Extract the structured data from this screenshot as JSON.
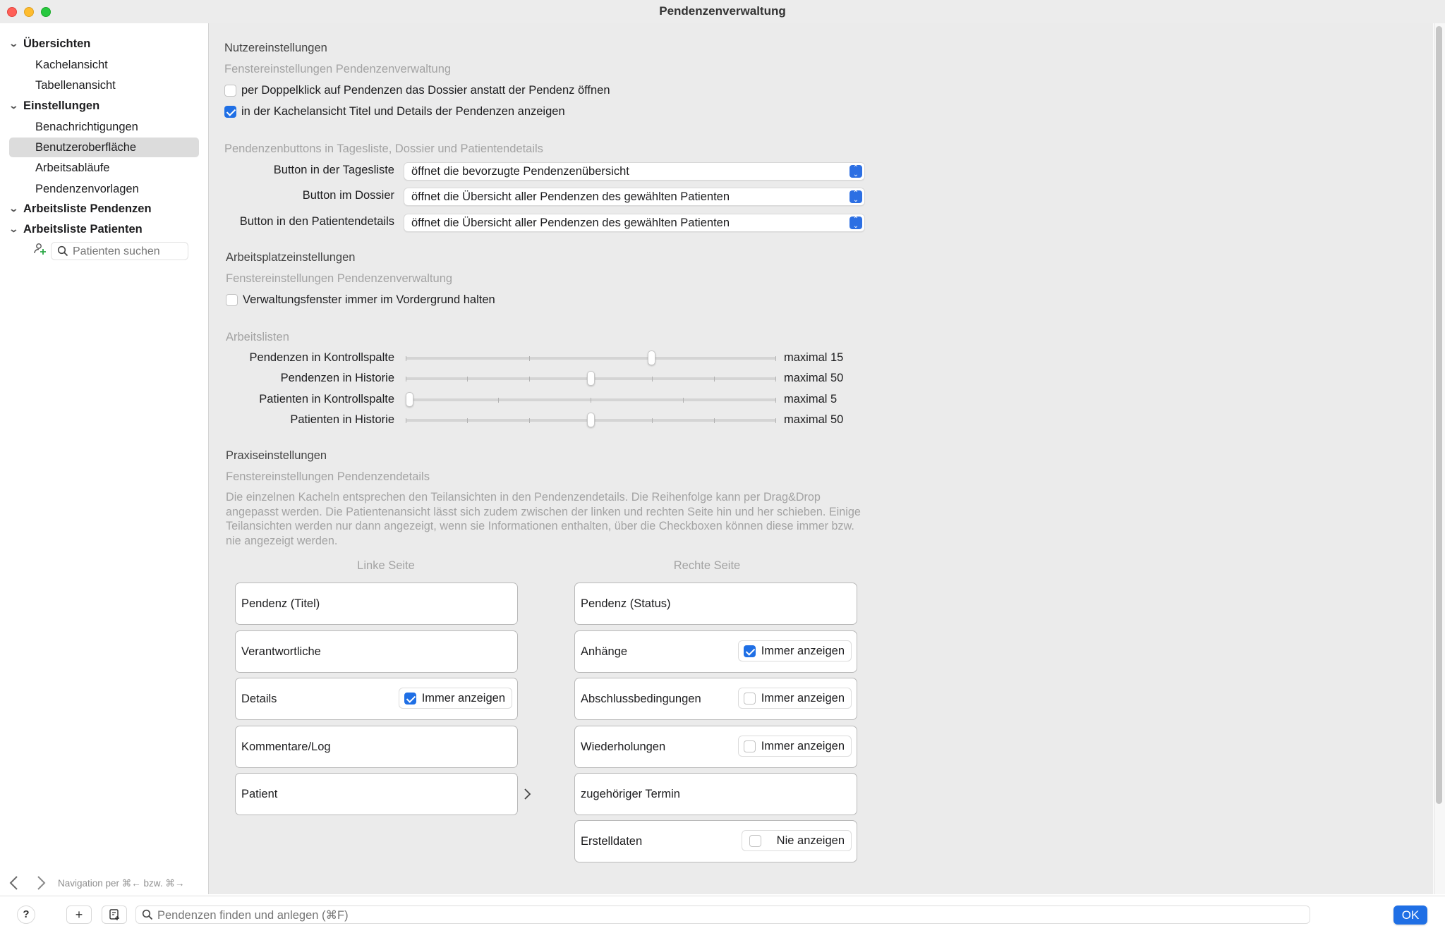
{
  "window": {
    "title": "Pendenzenverwaltung"
  },
  "sidebar": {
    "groups": [
      {
        "label": "Übersichten",
        "items": [
          "Kachelansicht",
          "Tabellenansicht"
        ]
      },
      {
        "label": "Einstellungen",
        "items": [
          "Benachrichtigungen",
          "Benutzeroberfläche",
          "Arbeitsabläufe",
          "Pendenzenvorlagen"
        ]
      },
      {
        "label": "Arbeitsliste Pendenzen",
        "items": []
      },
      {
        "label": "Arbeitsliste Patienten",
        "items": []
      }
    ],
    "selected_item": "Benutzeroberfläche",
    "patient_search_placeholder": "Patienten suchen",
    "nav_hint": "Navigation per ⌘← bzw. ⌘→"
  },
  "main": {
    "user_settings": {
      "heading": "Nutzereinstellungen",
      "subheading": "Fenstereinstellungen Pendenzenverwaltung",
      "checkboxes": [
        {
          "label": "per Doppelklick auf Pendenzen das Dossier anstatt der Pendenz öffnen",
          "checked": false
        },
        {
          "label": "in der Kachelansicht Titel und Details der Pendenzen anzeigen",
          "checked": true
        }
      ],
      "buttons_subheading": "Pendenzenbuttons in Tagesliste, Dossier und Patientendetails",
      "selects": [
        {
          "label": "Button in der Tagesliste",
          "value": "öffnet die bevorzugte Pendenzenübersicht"
        },
        {
          "label": "Button im Dossier",
          "value": "öffnet die Übersicht aller Pendenzen des gewählten Patienten"
        },
        {
          "label": "Button in den Patientendetails",
          "value": "öffnet die Übersicht aller Pendenzen des gewählten Patienten"
        }
      ]
    },
    "workplace_settings": {
      "heading": "Arbeitsplatzeinstellungen",
      "subheading": "Fenstereinstellungen Pendenzenverwaltung",
      "checkbox": {
        "label": "Verwaltungsfenster immer im Vordergrund halten",
        "checked": false
      },
      "lists_subheading": "Arbeitslisten",
      "sliders": [
        {
          "label": "Pendenzen in Kontrollspalte",
          "value_text": "maximal 15",
          "fraction": 0.667
        },
        {
          "label": "Pendenzen in Historie",
          "value_text": "maximal 50",
          "fraction": 0.5
        },
        {
          "label": "Patienten in Kontrollspalte",
          "value_text": "maximal 5",
          "fraction": 0.0
        },
        {
          "label": "Patienten in Historie",
          "value_text": "maximal 50",
          "fraction": 0.5
        }
      ]
    },
    "practice_settings": {
      "heading": "Praxiseinstellungen",
      "subheading": "Fenstereinstellungen Pendenzendetails",
      "description": "Die einzelnen Kacheln entsprechen den Teilansichten in den Pendenzendetails. Die Reihenfolge kann per Drag&Drop angepasst werden. Die Patientenansicht lässt sich zudem zwischen der linken und rechten Seite hin und her schieben. Einige Teilansichten werden nur dann angezeigt, wenn sie Informationen enthalten, über die Checkboxen können diese immer bzw. nie angezeigt werden.",
      "left_heading": "Linke Seite",
      "right_heading": "Rechte Seite",
      "left_tiles": [
        {
          "label": "Pendenz (Titel)"
        },
        {
          "label": "Verantwortliche"
        },
        {
          "label": "Details",
          "option": "Immer anzeigen",
          "checked": true
        },
        {
          "label": "Kommentare/Log"
        },
        {
          "label": "Patient"
        }
      ],
      "right_tiles": [
        {
          "label": "Pendenz (Status)"
        },
        {
          "label": "Anhänge",
          "option": "Immer anzeigen",
          "checked": true
        },
        {
          "label": "Abschlussbedingungen",
          "option": "Immer anzeigen",
          "checked": false
        },
        {
          "label": "Wiederholungen",
          "option": "Immer anzeigen",
          "checked": false
        },
        {
          "label": "zugehöriger Termin"
        },
        {
          "label": "Erstelldaten",
          "option": "Nie anzeigen",
          "checked": false
        }
      ]
    }
  },
  "bottombar": {
    "help_label": "?",
    "add_label": "+",
    "search_placeholder": "Pendenzen finden und anlegen (⌘F)",
    "ok_label": "OK"
  },
  "colors": {
    "accent": "#1f6fe5",
    "sidebar_selection": "#dcdcdc",
    "content_bg": "#ebebeb"
  }
}
